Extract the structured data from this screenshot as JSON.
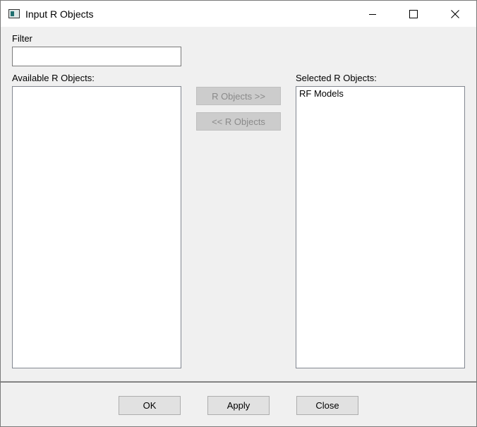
{
  "window": {
    "title": "Input R Objects"
  },
  "filter": {
    "label": "Filter",
    "value": ""
  },
  "available": {
    "label": "Available R Objects:",
    "items": []
  },
  "selected": {
    "label": "Selected R Objects:",
    "items": [
      "RF Models"
    ]
  },
  "move": {
    "add_label": "R Objects >>",
    "remove_label": "<< R Objects"
  },
  "footer": {
    "ok_label": "OK",
    "apply_label": "Apply",
    "close_label": "Close"
  }
}
